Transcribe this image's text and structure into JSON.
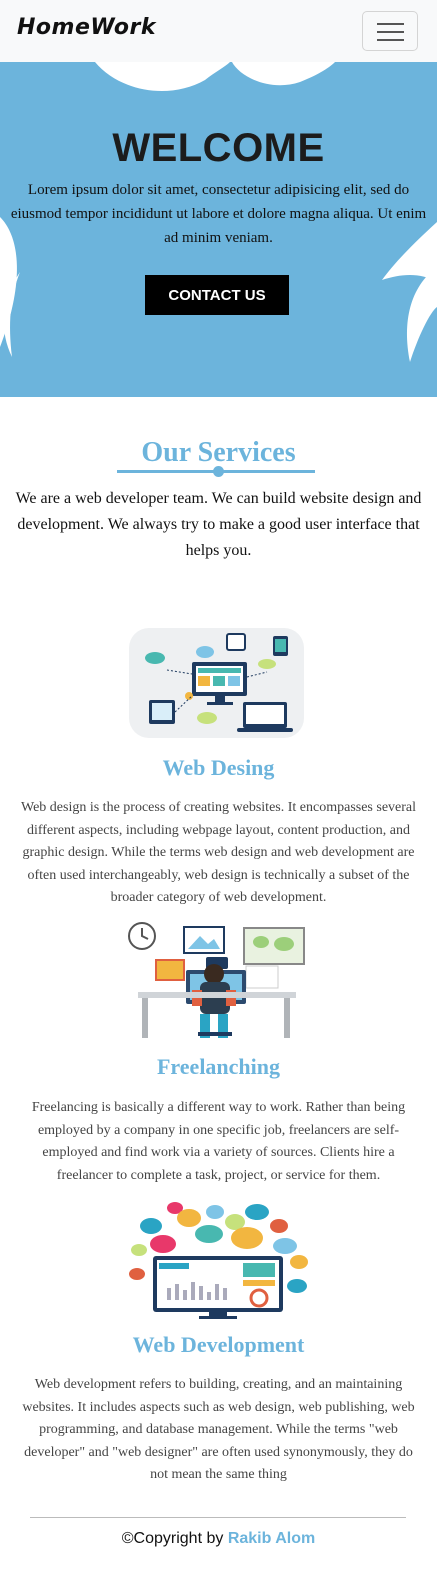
{
  "navbar": {
    "brand": "HomeWork",
    "menu_icon": "hamburger-menu-icon"
  },
  "hero": {
    "title": "WELCOME",
    "text": "Lorem ipsum dolor sit amet, consectetur adipisicing elit, sed do eiusmod tempor incididunt ut labore et dolore magna aliqua. Ut enim ad minim veniam.",
    "button_label": "CONTACT US",
    "background_color": "#6cb4dc"
  },
  "services": {
    "title": "Our Services",
    "intro": "We are a web developer team. We can build website design and development. We always try to make a good user interface that helps you.",
    "accent_color": "#6cb4dc",
    "items": [
      {
        "title": "Web Desing",
        "description": "Web design is the process of creating websites. It encompasses several different aspects, including webpage layout, content production, and graphic design. While the terms web design and web development are often used interchangeably, web design is technically a subset of the broader category of web development."
      },
      {
        "title": "Freelanching",
        "description": "Freelancing is basically a different way to work. Rather than being employed by a company in one specific job, freelancers are self-employed and find work via a variety of sources. Clients hire a freelancer to complete a task, project, or service for them."
      },
      {
        "title": "Web Development",
        "description": "Web development refers to building, creating, and an maintaining websites. It includes aspects such as web design, web publishing, web programming, and database management. While the terms \"web developer\" and \"web designer\" are often used synonymously, they do not mean the same thing"
      }
    ]
  },
  "footer": {
    "copyright_prefix": "©Copyright by ",
    "author": "Rakib Alom"
  }
}
